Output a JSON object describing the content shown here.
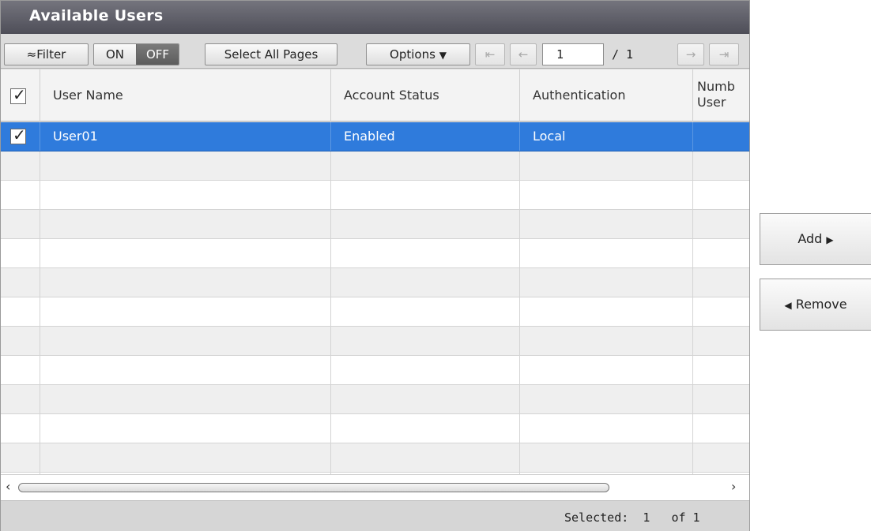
{
  "title": "Available Users",
  "toolbar": {
    "filter_label": "Filter",
    "filter_icon": "double-chevron-up-icon",
    "toggle_on": "ON",
    "toggle_off": "OFF",
    "select_all_label": "Select All Pages",
    "options_label": "Options",
    "page_value": "1",
    "page_total": "/ 1",
    "first_icon": "first-page-icon",
    "prev_icon": "prev-page-icon",
    "next_icon": "next-page-icon",
    "last_icon": "last-page-icon"
  },
  "table": {
    "columns": [
      "User Name",
      "Account Status",
      "Authentication",
      "Numb\nUser"
    ],
    "rows": [
      {
        "user_name": "User01",
        "account_status": "Enabled",
        "authentication": "Local",
        "number": "",
        "selected": true
      }
    ]
  },
  "status": {
    "text": "Selected:  1   of 1"
  },
  "actions": {
    "add_label": "Add",
    "remove_label": "Remove"
  },
  "colors": {
    "selection": "#2f7bdc",
    "titlebar": "#5f5f69"
  }
}
